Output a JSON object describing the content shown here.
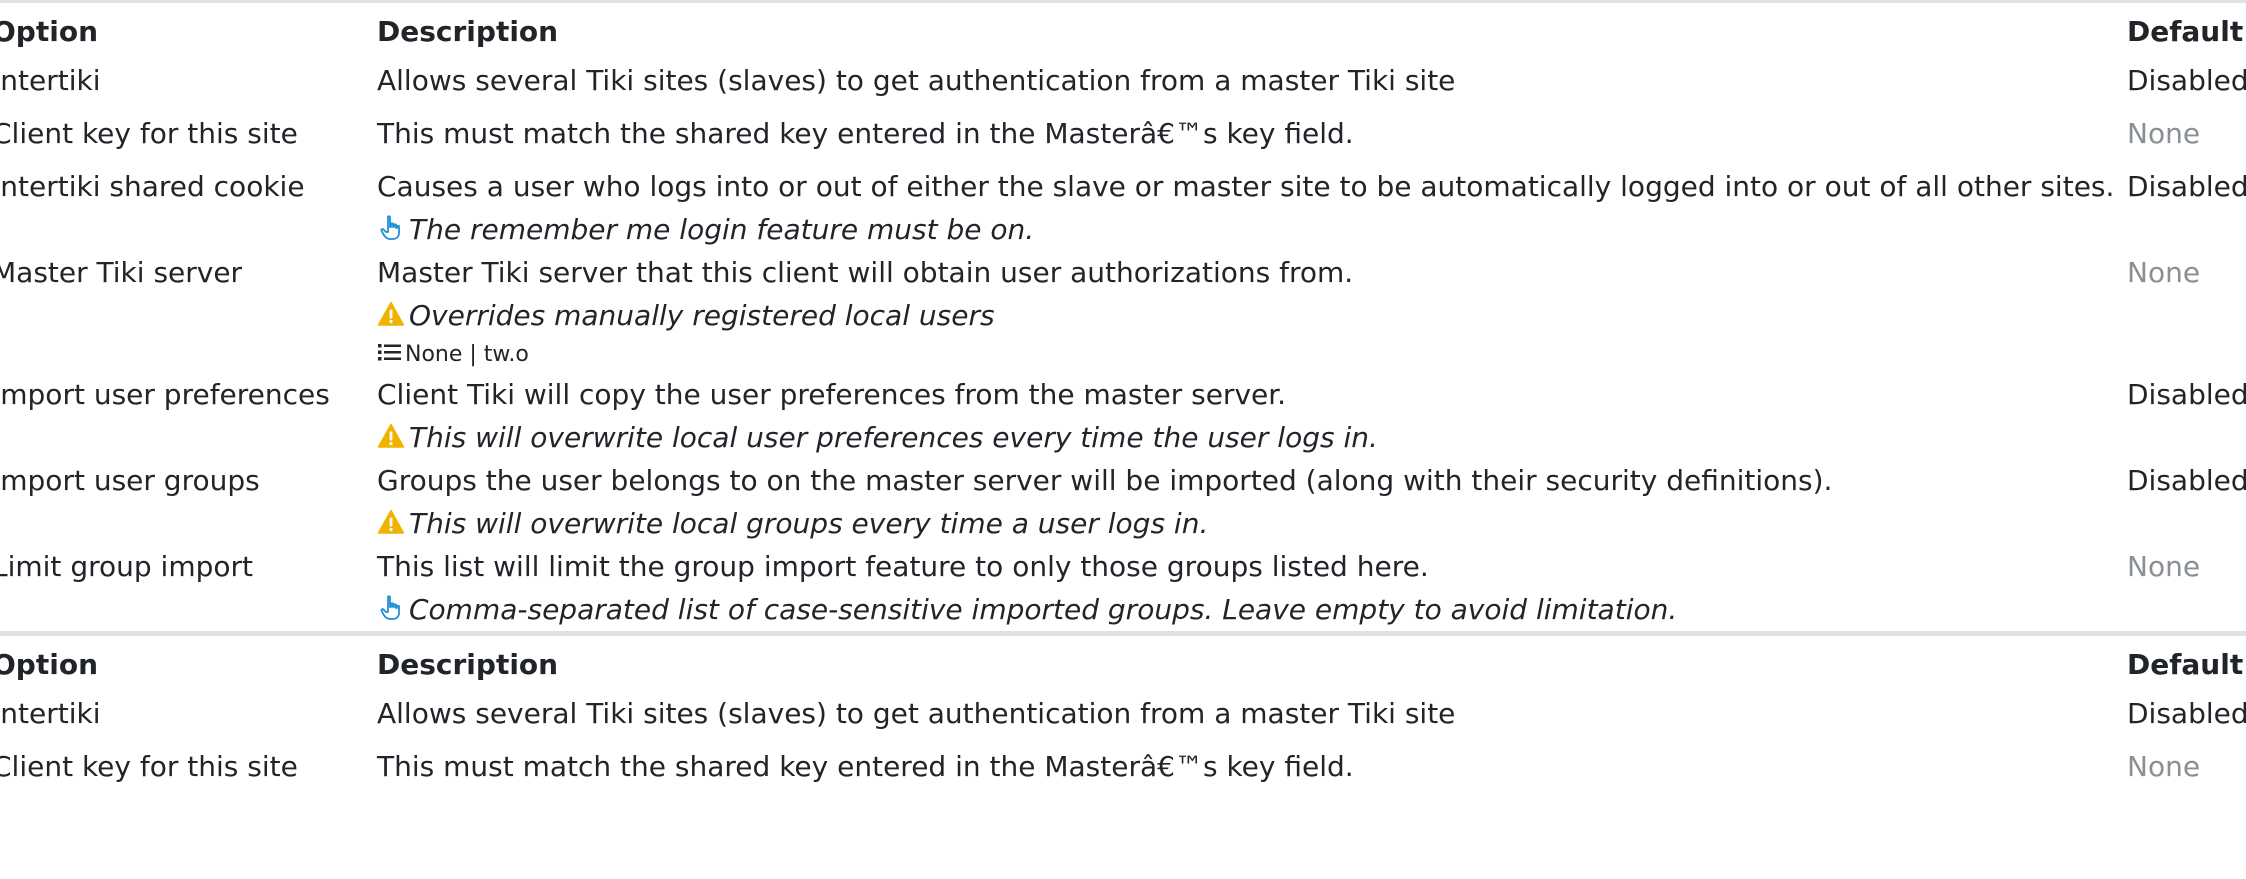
{
  "headers": {
    "option": "Option",
    "description": "Description",
    "default": "Default"
  },
  "rows": [
    {
      "option": "Intertiki",
      "description": "Allows several Tiki sites (slaves) to get authentication from a master Tiki site",
      "default": "Disabled"
    },
    {
      "option": "Client key for this site",
      "description": "This must match the shared key entered in the Masterâ€™s key field.",
      "default": "None"
    },
    {
      "option": "Intertiki shared cookie",
      "description": "Causes a user who logs into or out of either the slave or master site to be automatically logged into or out of all other sites.",
      "note": "The remember me login feature must be on.",
      "note_icon": "hand-point-icon",
      "default": "Disabled"
    },
    {
      "option": "Master Tiki server",
      "description": "Master Tiki server that this client will obtain user authorizations from.",
      "warning": "Overrides manually registered local users",
      "warning_icon": "warning-icon",
      "options_list": "None | tw.o",
      "options_icon": "list-icon",
      "default": "None"
    },
    {
      "option": "Import user preferences",
      "description": "Client Tiki will copy the user preferences from the master server.",
      "warning": "This will overwrite local user preferences every time the user logs in.",
      "warning_icon": "warning-icon",
      "default": "Disabled"
    },
    {
      "option": "Import user groups",
      "description": "Groups the user belongs to on the master server will be imported (along with their security definitions).",
      "warning": "This will overwrite local groups every time a user logs in.",
      "warning_icon": "warning-icon",
      "default": "Disabled"
    },
    {
      "option": "Limit group import",
      "description": "This list will limit the group import feature to only those groups listed here.",
      "note": "Comma-separated list of case-sensitive imported groups. Leave empty to avoid limitation.",
      "note_icon": "hand-point-icon",
      "default": "None"
    }
  ],
  "second_table": {
    "headers": {
      "option": "Option",
      "description": "Description",
      "default": "Default"
    },
    "rows": [
      {
        "option": "Intertiki",
        "description": "Allows several Tiki sites (slaves) to get authentication from a master Tiki site",
        "default": "Disabled"
      },
      {
        "option": "Client key for this site",
        "description": "This must match the shared key entered in the Masterâ€™s key field.",
        "default": "None"
      }
    ]
  },
  "colors": {
    "warning_icon": "#f0b400",
    "hand_icon": "#1f8fd6",
    "muted_default": "#8a8f94",
    "border": "#dee2e6"
  }
}
